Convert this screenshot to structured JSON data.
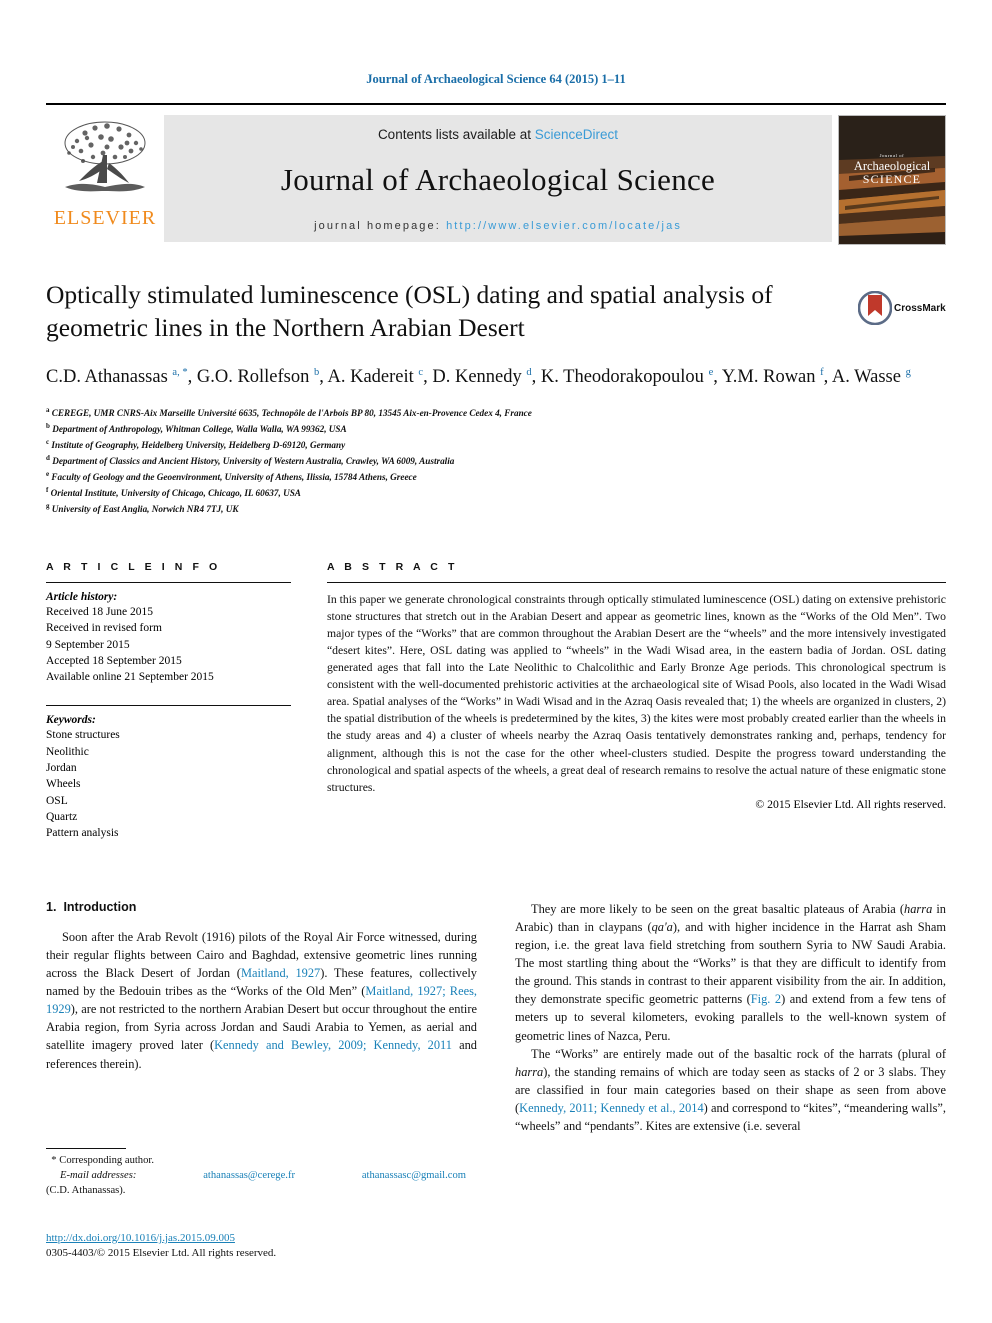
{
  "running_head": "Journal of Archaeological Science 64 (2015) 1–11",
  "masthead": {
    "contents_prefix": "Contents lists available at ",
    "sciencedirect": "ScienceDirect",
    "journal_name": "Journal of Archaeological Science",
    "homepage_label": "journal homepage:",
    "homepage_url": "http://www.elsevier.com/locate/jas",
    "publisher": "ELSEVIER",
    "cover": {
      "line1": "Journal of",
      "line2": "Archaeological",
      "line3": "SCIENCE"
    },
    "accent_blue": "#3a9bd6",
    "elsevier_orange": "#f08a1c"
  },
  "article": {
    "title": "Optically stimulated luminescence (OSL) dating and spatial analysis of geometric lines in the Northern Arabian Desert",
    "crossmark_label": "CrossMark",
    "authors": [
      {
        "name": "C.D. Athanassas",
        "marks": "a, *"
      },
      {
        "name": "G.O. Rollefson",
        "marks": "b"
      },
      {
        "name": "A. Kadereit",
        "marks": "c"
      },
      {
        "name": "D. Kennedy",
        "marks": "d"
      },
      {
        "name": "K. Theodorakopoulou",
        "marks": "e"
      },
      {
        "name": "Y.M. Rowan",
        "marks": "f"
      },
      {
        "name": "A. Wasse",
        "marks": "g"
      }
    ],
    "affiliations": [
      {
        "mark": "a",
        "text": "CEREGE, UMR CNRS-Aix Marseille Université 6635, Technopôle de l'Arbois BP 80, 13545 Aix-en-Provence Cedex 4, France"
      },
      {
        "mark": "b",
        "text": "Department of Anthropology, Whitman College, Walla Walla, WA 99362, USA"
      },
      {
        "mark": "c",
        "text": "Institute of Geography, Heidelberg University, Heidelberg D-69120, Germany"
      },
      {
        "mark": "d",
        "text": "Department of Classics and Ancient History, University of Western Australia, Crawley, WA 6009, Australia"
      },
      {
        "mark": "e",
        "text": "Faculty of Geology and the Geoenvironment, University of Athens, Ilissia, 15784 Athens, Greece"
      },
      {
        "mark": "f",
        "text": "Oriental Institute, University of Chicago, Chicago, IL 60637, USA"
      },
      {
        "mark": "g",
        "text": "University of East Anglia, Norwich NR4 7TJ, UK"
      }
    ]
  },
  "article_info": {
    "heading": "A R T I C L E   I N F O",
    "history_label": "Article history:",
    "history": [
      "Received 18 June 2015",
      "Received in revised form",
      "9 September 2015",
      "Accepted 18 September 2015",
      "Available online 21 September 2015"
    ],
    "keywords_label": "Keywords:",
    "keywords": [
      "Stone structures",
      "Neolithic",
      "Jordan",
      "Wheels",
      "OSL",
      "Quartz",
      "Pattern analysis"
    ]
  },
  "abstract": {
    "heading": "A B S T R A C T",
    "text": "In this paper we generate chronological constraints through optically stimulated luminescence (OSL) dating on extensive prehistoric stone structures that stretch out in the Arabian Desert and appear as geometric lines, known as the “Works of the Old Men”. Two major types of the “Works” that are common throughout the Arabian Desert are the “wheels” and the more intensively investigated “desert kites”. Here, OSL dating was applied to “wheels” in the Wadi Wisad area, in the eastern badia of Jordan. OSL dating generated ages that fall into the Late Neolithic to Chalcolithic and Early Bronze Age periods. This chronological spectrum is consistent with the well-documented prehistoric activities at the archaeological site of Wisad Pools, also located in the Wadi Wisad area. Spatial analyses of the “Works” in Wadi Wisad and in the Azraq Oasis revealed that; 1) the wheels are organized in clusters, 2) the spatial distribution of the wheels is predetermined by the kites, 3) the kites were most probably created earlier than the wheels in the study areas and 4) a cluster of wheels nearby the Azraq Oasis tentatively demonstrates ranking and, perhaps, tendency for alignment, although this is not the case for the other wheel-clusters studied. Despite the progress toward understanding the chronological and spatial aspects of the wheels, a great deal of research remains to resolve the actual nature of these enigmatic stone structures.",
    "copyright": "© 2015 Elsevier Ltd. All rights reserved."
  },
  "introduction": {
    "number": "1.",
    "title": "Introduction",
    "para1_a": "Soon after the Arab Revolt (1916) pilots of the Royal Air Force witnessed, during their regular flights between Cairo and Baghdad, extensive geometric lines running across the Black Desert of Jordan (",
    "ref1": "Maitland, 1927",
    "para1_b": "). These features, collectively named by the Bedouin tribes as the “Works of the Old Men” (",
    "ref2": "Maitland, 1927; Rees, 1929",
    "para1_c": "), are not restricted to the northern Arabian Desert but occur throughout the entire Arabia region, from Syria across Jordan and Saudi Arabia to Yemen, as aerial and satellite imagery proved later (",
    "ref3": "Kennedy and Bewley, 2009; Kennedy, 2011",
    "para1_d": " and references therein)."
  },
  "right_column": {
    "para2_a": "They are more likely to be seen on the great basaltic plateaus of Arabia (",
    "ital1": "harra",
    "para2_b": " in Arabic) than in claypans (",
    "ital2": "qa'a",
    "para2_c": "), and with higher incidence in the Harrat ash Sham region, i.e. the great lava field stretching from southern Syria to NW Saudi Arabia. The most startling thing about the “Works” is that they are difficult to identify from the ground. This stands in contrast to their apparent visibility from the air. In addition, they demonstrate specific geometric patterns (",
    "ref_fig2": "Fig. 2",
    "para2_d": ") and extend from a few tens of meters up to several kilometers, evoking parallels to the well-known system of geometric lines of Nazca, Peru.",
    "para3_a": "The “Works” are entirely made out of the basaltic rock of the harrats (plural of ",
    "ital3": "harra",
    "para3_b": "), the standing remains of which are today seen as stacks of 2 or 3 slabs. They are classified in four main categories based on their shape as seen from above (",
    "ref4": "Kennedy, 2011; Kennedy et al., 2014",
    "para3_c": ") and correspond to “kites”, “meandering walls”, “wheels” and “pendants”. Kites are extensive (i.e. several"
  },
  "footer": {
    "corresponding_mark": "*",
    "corresponding_label": "Corresponding author.",
    "email_label": "E-mail addresses:",
    "email1": "athanassas@cerege.fr",
    "email2": "athanassasc@gmail.com",
    "email_owner": "(C.D. Athanassas).",
    "doi": "http://dx.doi.org/10.1016/j.jas.2015.09.005",
    "issn": "0305-4403/© 2015 Elsevier Ltd. All rights reserved."
  }
}
